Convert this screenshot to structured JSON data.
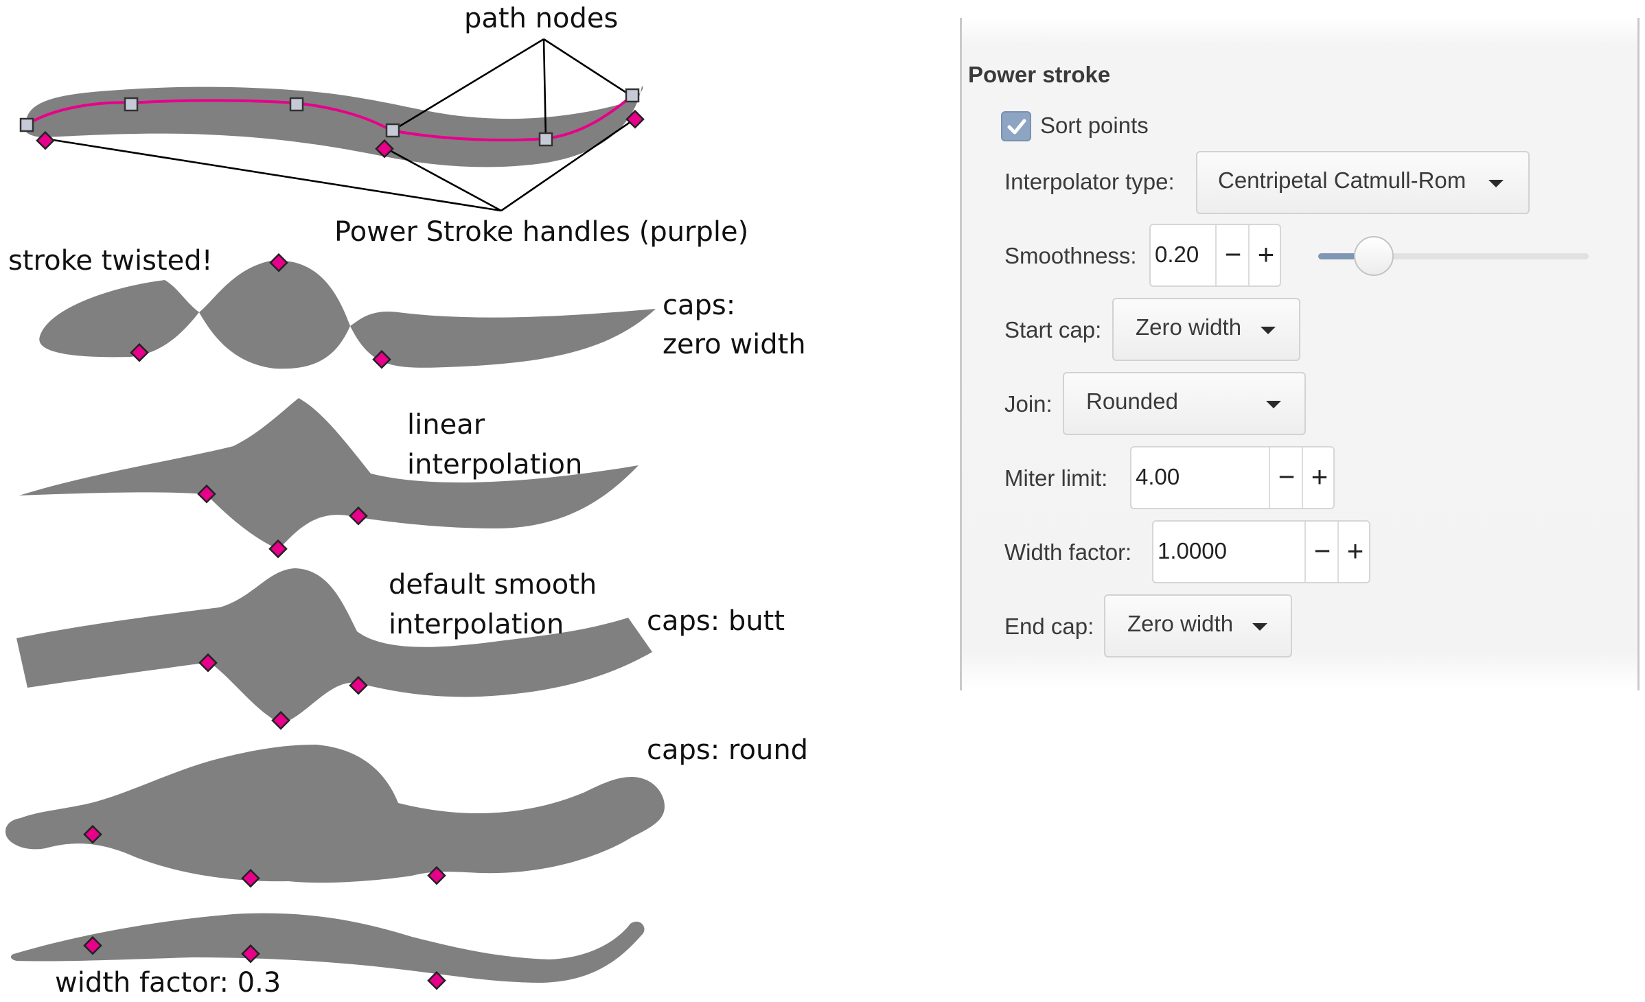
{
  "figure": {
    "annotations": {
      "path_nodes": "path nodes",
      "handles": "Power Stroke handles (purple)",
      "twisted": "stroke twisted!",
      "caps_zero_line1": "caps:",
      "caps_zero_line2": "zero width",
      "linear_line1": "linear",
      "linear_line2": "interpolation",
      "smooth_line1": "default smooth",
      "smooth_line2": "interpolation",
      "caps_butt": "caps: butt",
      "caps_round": "caps: round",
      "width_factor": "width factor: 0.3"
    },
    "colors": {
      "stroke_fill": "#808080",
      "handle": "#e8008a",
      "path": "#e8008a",
      "node": "#c6cad6"
    }
  },
  "panel": {
    "title": "Power stroke",
    "sort_points": {
      "label": "Sort points",
      "checked": true
    },
    "interpolator": {
      "label": "Interpolator type:",
      "value": "Centripetal Catmull-Rom"
    },
    "smoothness": {
      "label": "Smoothness:",
      "value": "0.20",
      "slider_fraction": 0.2
    },
    "start_cap": {
      "label": "Start cap:",
      "value": "Zero width"
    },
    "join": {
      "label": "Join:",
      "value": "Rounded"
    },
    "miter_limit": {
      "label": "Miter limit:",
      "value": "4.00"
    },
    "width_factor": {
      "label": "Width factor:",
      "value": "1.0000"
    },
    "end_cap": {
      "label": "End cap:",
      "value": "Zero width"
    },
    "icons": {
      "minus": "−",
      "plus": "+",
      "check": "check-icon",
      "caret": "caret-down-icon"
    },
    "accent": "#8da4c3"
  }
}
